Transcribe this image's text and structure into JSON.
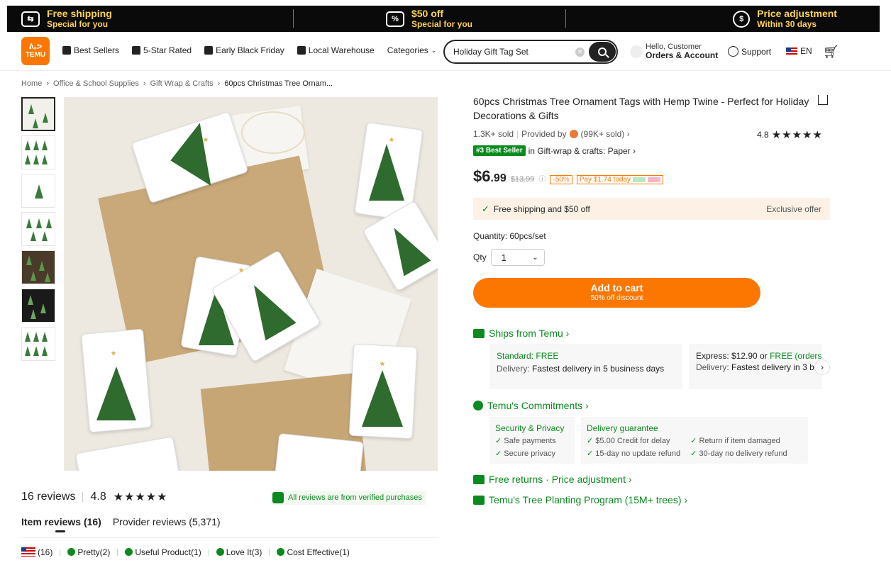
{
  "promo": {
    "item1": {
      "icon": "truck-icon",
      "line1": "Free shipping",
      "line2": "Special for you"
    },
    "item2": {
      "icon": "coupon-icon",
      "line1": "$50 off",
      "line2": "Special for you"
    },
    "item3": {
      "icon": "price-adjust-icon",
      "line1": "Price adjustment",
      "line2": "Within 30 days"
    }
  },
  "header": {
    "logo_line1": "ᕕ₀ᕗ",
    "logo_line2": "TEMU",
    "nav": {
      "best_sellers": "Best Sellers",
      "five_star": "5-Star Rated",
      "early_bf": "Early Black Friday",
      "local_warehouse": "Local Warehouse",
      "categories": "Categories"
    },
    "search_value": "Holiday Gift Tag Set",
    "account_line1": "Hello, Customer",
    "account_line2": "Orders & Account",
    "support": "Support",
    "lang": "EN"
  },
  "breadcrumb": {
    "home": "Home",
    "c1": "Office & School Supplies",
    "c2": "Gift Wrap & Crafts",
    "current": "60pcs Christmas Tree Ornam..."
  },
  "reviews": {
    "count": "16 reviews",
    "rating": "4.8",
    "stars": "★★★★★",
    "verified": "All reviews are from verified purchases",
    "tab_item": "Item reviews (16)",
    "tab_provider": "Provider reviews (5,371)",
    "filters": {
      "us": "(16)",
      "pretty": "Pretty(2)",
      "useful": "Useful Product(1)",
      "love": "Love It(3)",
      "cost": "Cost Effective(1)"
    }
  },
  "product": {
    "title": "60pcs Christmas Tree Ornament Tags with Hemp Twine - Perfect for Holiday Decorations & Gifts",
    "sold": "1.3K+ sold",
    "provided_by": "Provided by",
    "provider_sold": "(99K+ sold) ›",
    "rating": "4.8",
    "stars": "★★★★★",
    "badge": "#3 Best Seller",
    "badge_text": "in Gift-wrap & crafts: Paper ›",
    "price_dollar": "$6",
    "price_cents": ".99",
    "orig_price": "$13.99",
    "discount": "-50%",
    "pay_today": "Pay $1.74 today",
    "offer": "Free shipping and $50 off",
    "offer_right": "Exclusive offer",
    "quantity_label": "Quantity: 60pcs/set",
    "qty_label": "Qty",
    "qty_value": "1",
    "add_to_cart": "Add to cart",
    "add_sub": "50% off discount",
    "ships_from": "Ships from Temu ›",
    "standard_title": "Standard: FREE",
    "standard_delivery_k": "Delivery:",
    "standard_delivery_v": "Fastest delivery in 5 business days",
    "express_title": "Express: $12.90 or",
    "express_free": "FREE (orders",
    "express_delivery_k": "Delivery:",
    "express_delivery_v": "Fastest delivery in 3 bu",
    "commitments": "Temu's Commitments ›",
    "security_title": "Security & Privacy",
    "safe_payments": "Safe payments",
    "secure_privacy": "Secure privacy",
    "delivery_title": "Delivery guarantee",
    "credit": "$5.00 Credit for delay",
    "no_update": "15-day no update refund",
    "return_damaged": "Return if item damaged",
    "no_delivery": "30-day no delivery refund",
    "free_returns": "Free returns · Price adjustment ›",
    "tree_program": "Temu's Tree Planting Program (15M+ trees) ›"
  },
  "colors": {
    "brand": "#fb7701",
    "green": "#0a8a1f",
    "promo_text": "#ffd34d"
  }
}
